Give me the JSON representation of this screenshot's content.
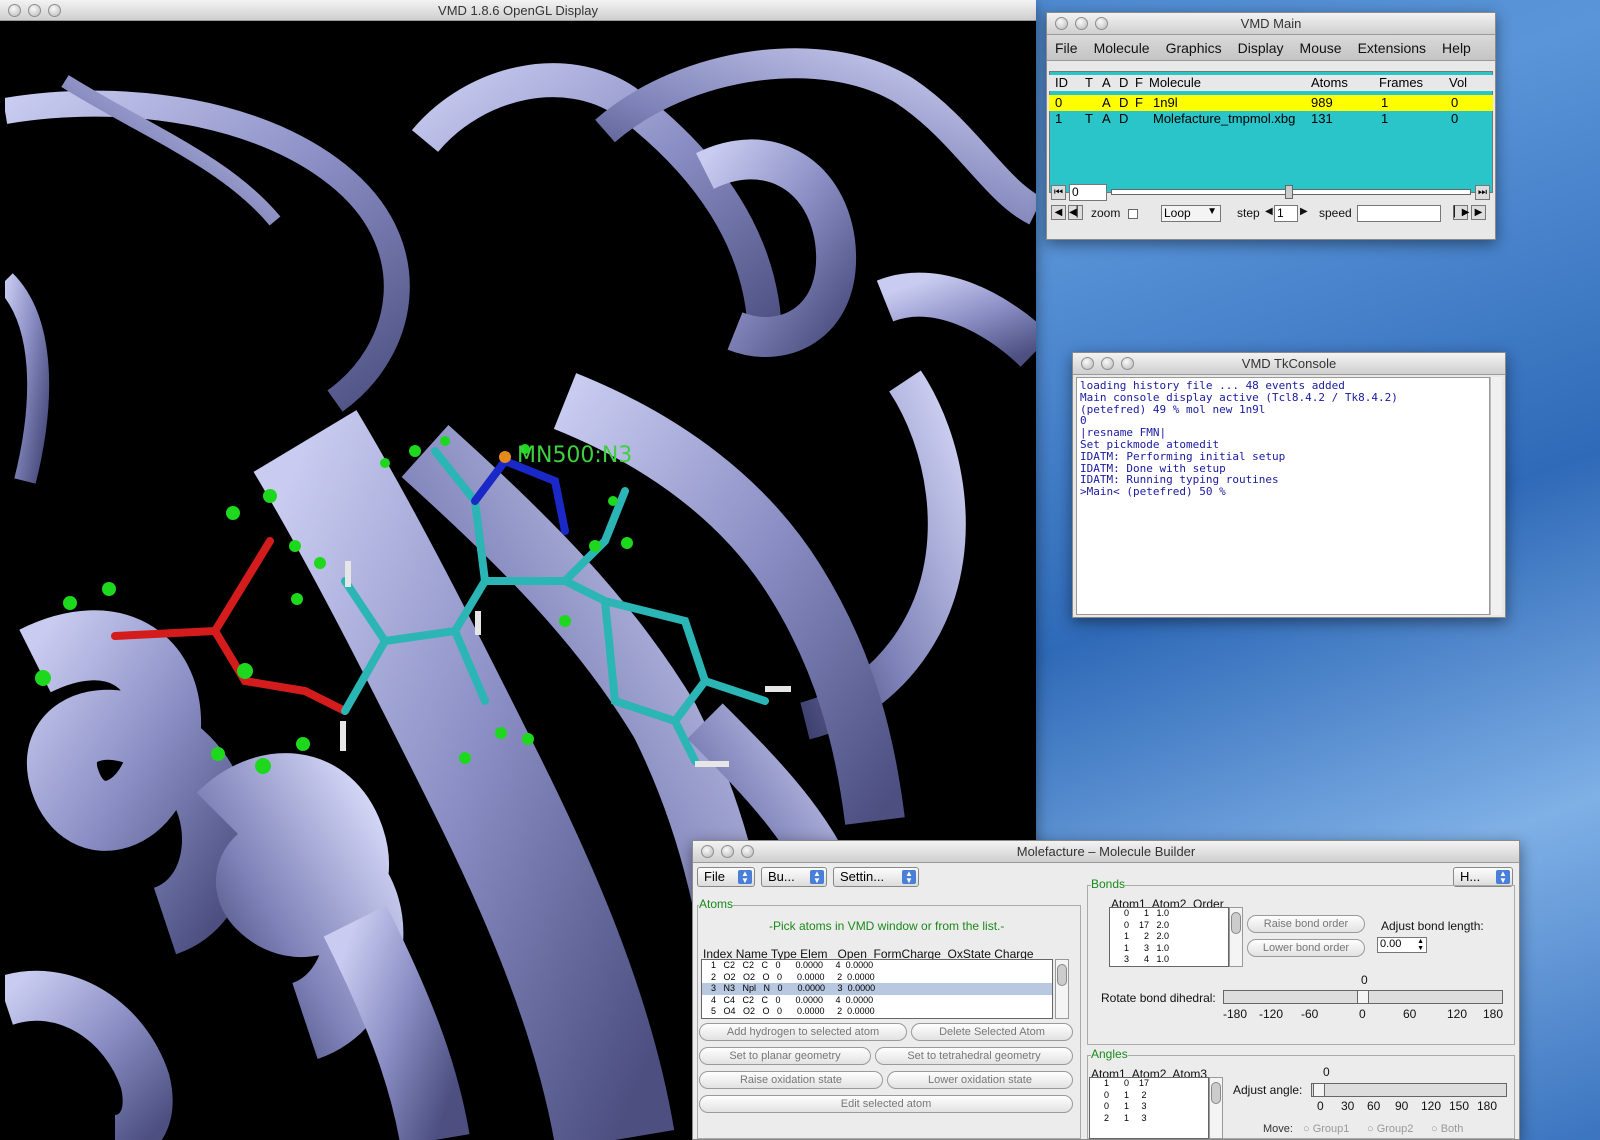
{
  "gl_window": {
    "title": "VMD 1.8.6 OpenGL Display",
    "atom_label": "MN500:N3"
  },
  "main_window": {
    "title": "VMD Main",
    "menu": [
      "File",
      "Molecule",
      "Graphics",
      "Display",
      "Mouse",
      "Extensions",
      "Help"
    ],
    "columns": {
      "id": "ID",
      "t": "T",
      "a": "A",
      "d": "D",
      "f": "F",
      "molecule": "Molecule",
      "atoms": "Atoms",
      "frames": "Frames",
      "vol": "Vol"
    },
    "molecules": [
      {
        "id": "0",
        "t": "",
        "a": "A",
        "d": "D",
        "f": "F",
        "name": "1n9l",
        "atoms": "989",
        "frames": "1",
        "vol": "0"
      },
      {
        "id": "1",
        "t": "T",
        "a": "A",
        "d": "D",
        "f": "",
        "name": "Molefacture_tmpmol.xbg",
        "atoms": "131",
        "frames": "1",
        "vol": "0"
      }
    ],
    "frame_value": "0",
    "zoom_label": "zoom",
    "loop_mode": "Loop",
    "step_label": "step",
    "step_value": "1",
    "speed_label": "speed"
  },
  "console_window": {
    "title": "VMD TkConsole",
    "text": "loading history file ... 48 events added\nMain console display active (Tcl8.4.2 / Tk8.4.2)\n(petefred) 49 % mol new 1n9l\n0\n|resname FMN|\nSet pickmode atomedit\nIDATM: Performing initial setup\nIDATM: Done with setup\nIDATM: Running typing routines\n>Main< (petefred) 50 %"
  },
  "molefacture": {
    "title": "Molefacture – Molecule Builder",
    "menus": {
      "file": "File",
      "build": "Bu...",
      "settings": "Settin...",
      "help": "H..."
    },
    "atoms": {
      "label": "Atoms",
      "hint": "-Pick atoms in VMD window or from the list.-",
      "header": "Index Name Type Elem   Open  FormCharge  OxState Charge",
      "rows": [
        "  1   C2   C2   C   0      0.0000     4  0.0000",
        "  2   O2   O2   O   0      0.0000     2  0.0000",
        "  3   N3   Npl   N   0      0.0000     3  0.0000",
        "  4   C4   C2   C   0      0.0000     4  0.0000",
        "  5   O4   O2   O   0      0.0000     2  0.0000"
      ],
      "highlight_row": 2,
      "buttons": {
        "add_h": "Add hydrogen to selected atom",
        "delete": "Delete Selected Atom",
        "planar": "Set to planar geometry",
        "tetra": "Set to tetrahedral geometry",
        "raise_ox": "Raise oxidation state",
        "lower_ox": "Lower oxidation state",
        "edit": "Edit selected atom"
      }
    },
    "bonds": {
      "label": "Bonds",
      "header": "Atom1  Atom2  Order",
      "rows": [
        "    0      1   1.0",
        "    0    17   2.0",
        "    1      2   2.0",
        "    1      3   1.0",
        "    3      4   1.0"
      ],
      "raise": "Raise bond order",
      "lower": "Lower bond order",
      "adjust_length_label": "Adjust bond length:",
      "length_value": "0.00",
      "dihedral_label": "Rotate bond dihedral:",
      "dihedral_value": 0,
      "dihedral_value_text": "0",
      "dihedral_ticks": [
        "-180",
        "-120",
        "-60",
        "0",
        "60",
        "120",
        "180"
      ]
    },
    "angles": {
      "label": "Angles",
      "header": "Atom1  Atom2  Atom3",
      "rows": [
        "    1      0    17",
        "    0      1     2",
        "    0      1     3",
        "    2      1     3"
      ],
      "adjust_label": "Adjust angle:",
      "angle_value_text": "0",
      "angle_ticks": [
        "0",
        "30",
        "60",
        "90",
        "120",
        "150",
        "180"
      ],
      "move_label": "Move:",
      "move_options": [
        "Group1",
        "Group2",
        "Both"
      ]
    }
  }
}
